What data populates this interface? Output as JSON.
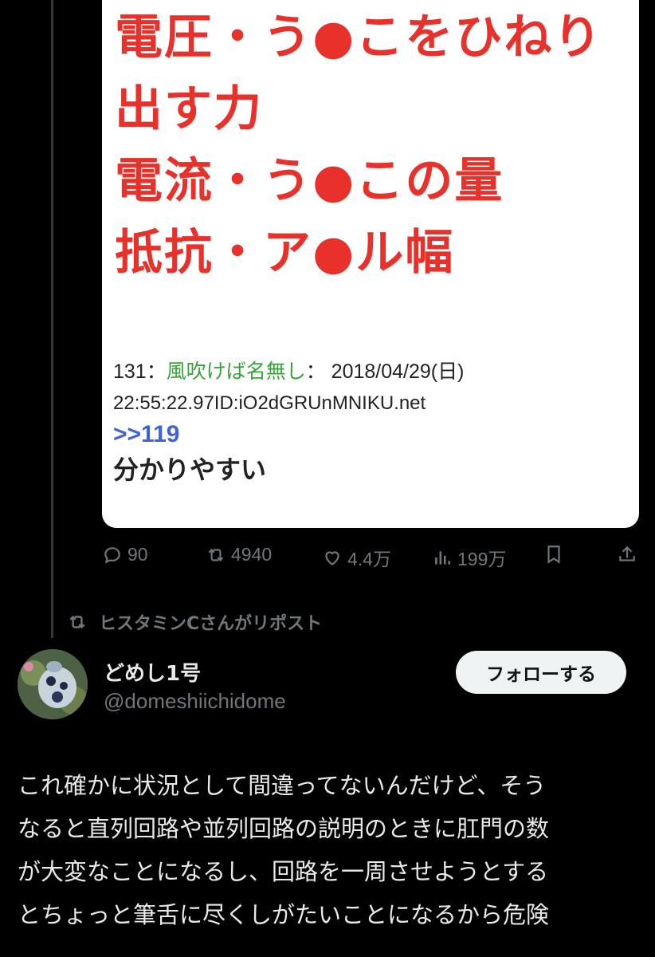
{
  "card": {
    "red_lines": [
      "電圧・う●こをひねり",
      "出す力",
      "電流・う●この量",
      "抵抗・ア●ル幅"
    ],
    "post_number": "131：",
    "poster_name": "風吹けば名無し",
    "post_date": "： 2018/04/29(日)",
    "post_id_line": "22:55:22.97ID:iO2dGRUnMNIKU.net",
    "reply_ref": ">>119",
    "reply_text": "分かりやすい"
  },
  "actions": {
    "replies": "90",
    "reposts": "4940",
    "likes": "4.4万",
    "views": "199万"
  },
  "repost_banner": "ヒスタミンCさんがリポスト",
  "author": {
    "display_name": "どめし1号",
    "handle": "@domeshiichidome"
  },
  "follow_label": "フォローする",
  "tweet_lines": [
    "これ確かに状況として間違ってないんだけど、そう",
    "なると直列回路や並列回路の説明のときに肛門の数",
    "が大変なことになるし、回路を一周させようとする",
    "とちょっと筆舌に尽くしがたいことになるから危険"
  ],
  "colors": {
    "red_text": "#e8312a",
    "poster_name": "#3aa33a",
    "reply_ref": "#3e63d6",
    "secondary": "#71767b"
  }
}
